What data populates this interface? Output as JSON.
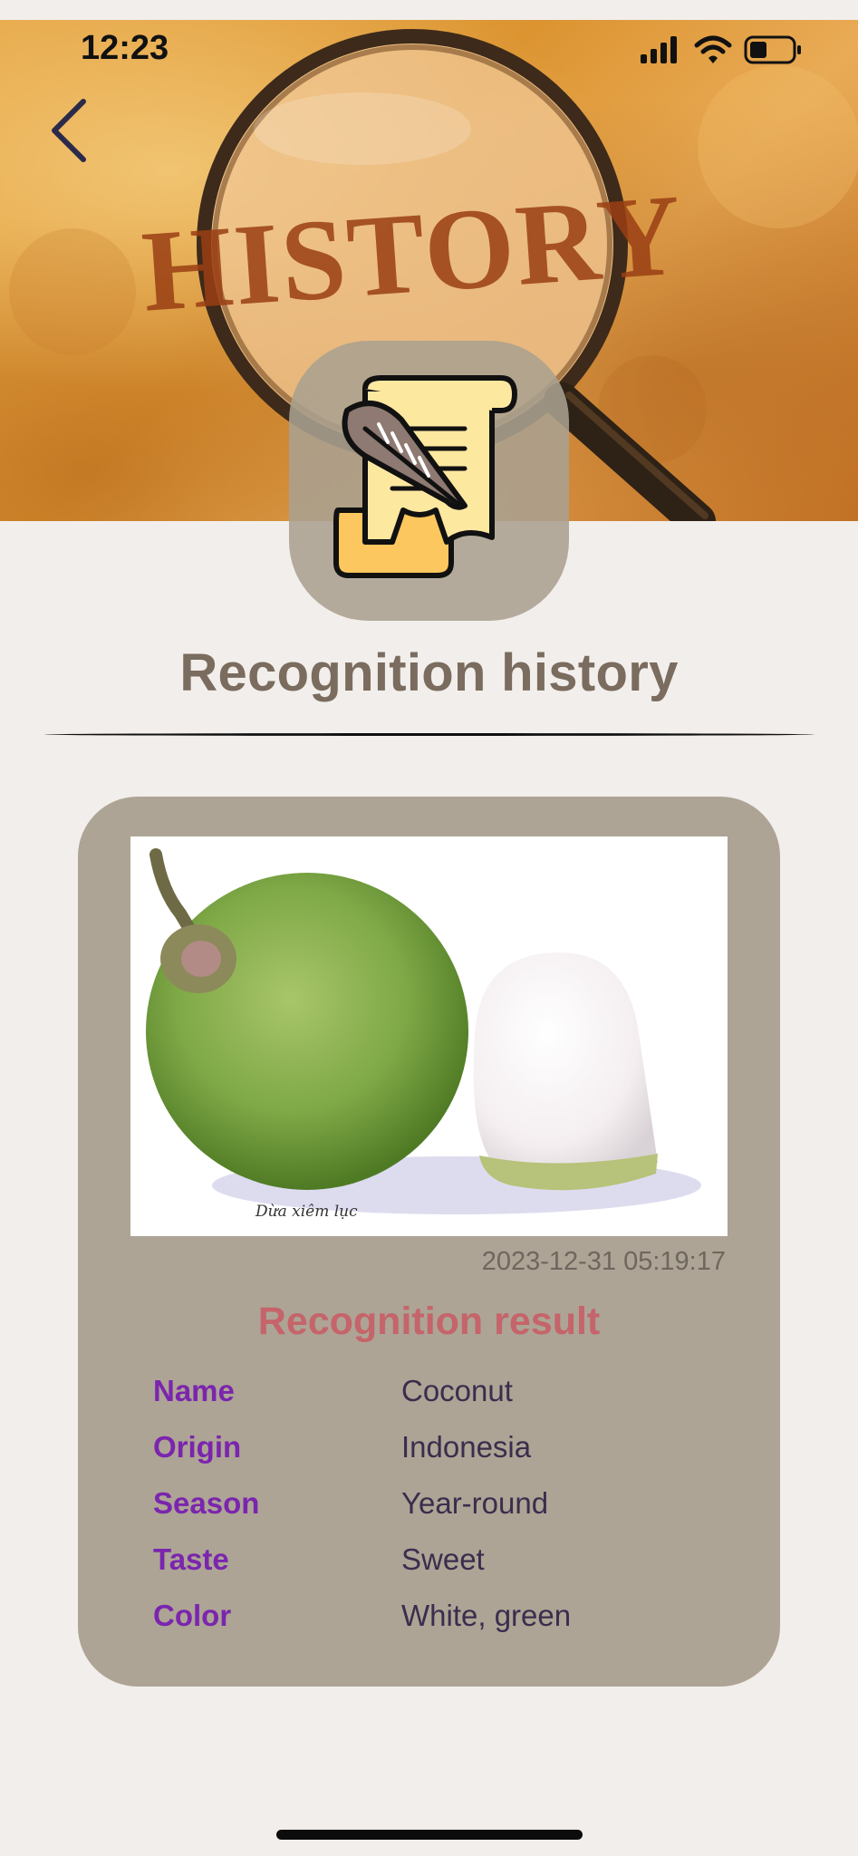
{
  "status_bar": {
    "time": "12:23",
    "icons": [
      "signal-icon",
      "wifi-icon",
      "battery-icon"
    ]
  },
  "header": {
    "banner_text": "HISTORY",
    "back_icon": "chevron-left-icon",
    "badge_icon": "scroll-quill-icon"
  },
  "page": {
    "title": "Recognition history"
  },
  "record": {
    "image_caption": "Dừa xiêm lục",
    "timestamp": "2023-12-31 05:19:17",
    "result_title": "Recognition result",
    "fields": [
      {
        "label": "Name",
        "value": "Coconut"
      },
      {
        "label": "Origin",
        "value": "Indonesia"
      },
      {
        "label": "Season",
        "value": "Year-round"
      },
      {
        "label": "Taste",
        "value": "Sweet"
      },
      {
        "label": "Color",
        "value": "White, green"
      }
    ]
  },
  "colors": {
    "background": "#f2eeeb",
    "card": "#ada495",
    "title": "#7a6c5e",
    "result_title": "#c5646a",
    "label": "#7b25ae",
    "value": "#3b2d4d"
  }
}
